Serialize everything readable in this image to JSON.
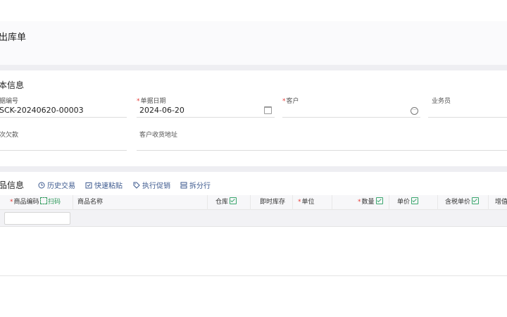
{
  "page": {
    "title": "出库单"
  },
  "basic": {
    "section_title": "本信息",
    "doc_no_label": "据编号",
    "doc_no_value": "SCK-20240620-00003",
    "date_label": "单据日期",
    "date_value": "2024-06-20",
    "customer_label": "客户",
    "salesperson_label": "业务员",
    "arrears_label": "次欠款",
    "address_label": "客户收货地址"
  },
  "goods": {
    "section_title": "品信息",
    "tools": [
      "历史交易",
      "快速粘贴",
      "执行促销",
      "拆分行"
    ]
  },
  "table": {
    "headers": {
      "code": "商品编码",
      "scan": "扫码",
      "name": "商品名称",
      "warehouse": "仓库",
      "stock": "即时库存",
      "unit": "单位",
      "qty": "数量",
      "price": "单价",
      "tax_price": "含税单价",
      "extra": "增值"
    },
    "required_marker": "*"
  },
  "colors": {
    "accent": "#3d5a8f",
    "required": "#e53935",
    "check": "#3aa76d"
  }
}
